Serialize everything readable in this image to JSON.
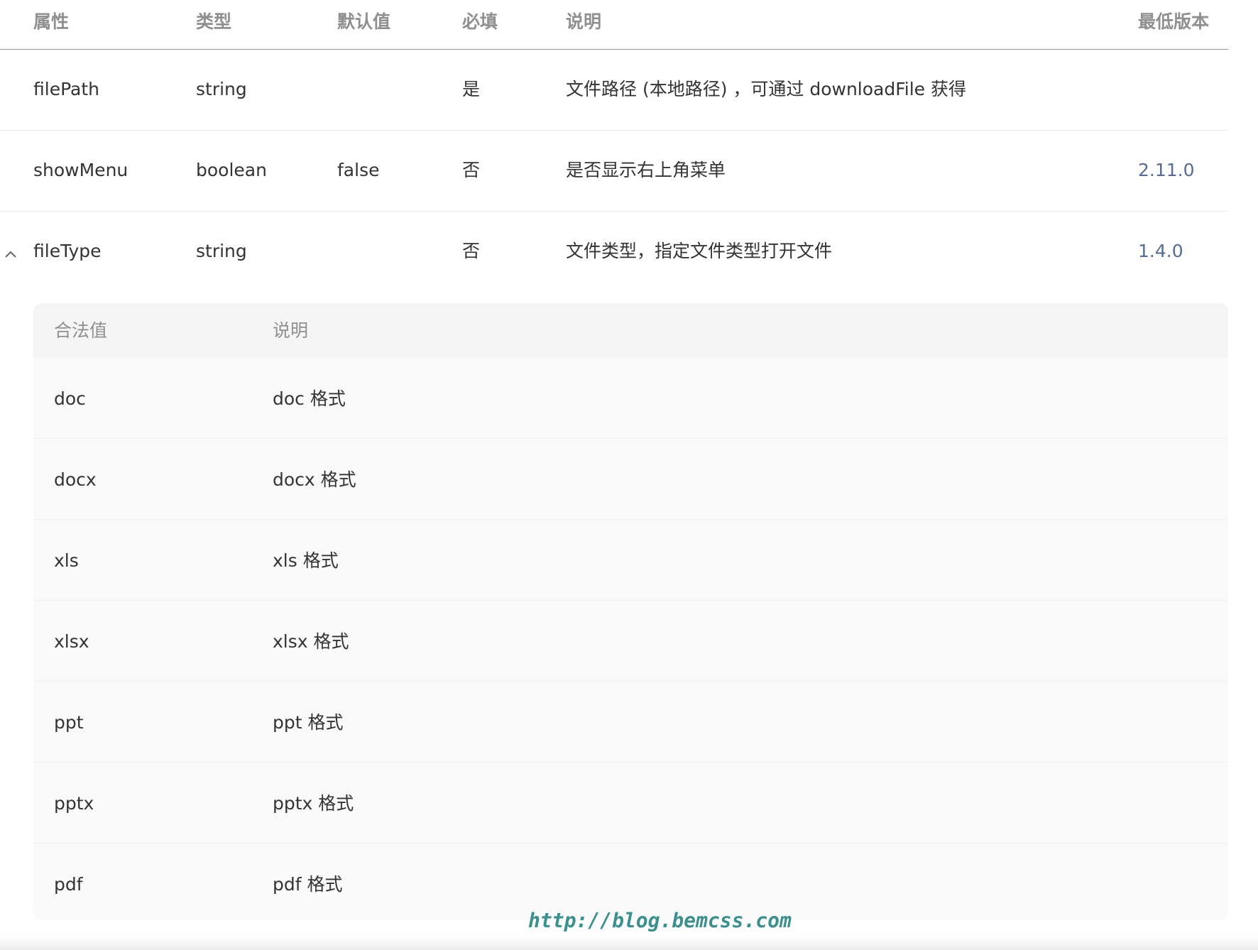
{
  "table": {
    "headers": {
      "prop": "属性",
      "type": "类型",
      "default": "默认值",
      "required": "必填",
      "desc": "说明",
      "version": "最低版本"
    },
    "rows": [
      {
        "prop": "filePath",
        "type": "string",
        "default": "",
        "required": "是",
        "desc": "文件路径 (本地路径) ，可通过 downloadFile 获得",
        "version": ""
      },
      {
        "prop": "showMenu",
        "type": "boolean",
        "default": "false",
        "required": "否",
        "desc": "是否显示右上角菜单",
        "version": "2.11.0"
      },
      {
        "prop": "fileType",
        "type": "string",
        "default": "",
        "required": "否",
        "desc": "文件类型，指定文件类型打开文件",
        "version": "1.4.0",
        "expanded": true
      }
    ]
  },
  "subtable": {
    "headers": {
      "value": "合法值",
      "desc": "说明"
    },
    "rows": [
      {
        "value": "doc",
        "desc": "doc 格式"
      },
      {
        "value": "docx",
        "desc": "docx 格式"
      },
      {
        "value": "xls",
        "desc": "xls 格式"
      },
      {
        "value": "xlsx",
        "desc": "xlsx 格式"
      },
      {
        "value": "ppt",
        "desc": "ppt 格式"
      },
      {
        "value": "pptx",
        "desc": "pptx 格式"
      },
      {
        "value": "pdf",
        "desc": "pdf 格式"
      }
    ]
  },
  "watermark": "http://blog.bemcss.com",
  "colors": {
    "link": "#576b95",
    "header_text": "#8f8f8f",
    "watermark": "#3a8f8f"
  },
  "icons": {
    "toggle": "chevron-up-icon"
  }
}
